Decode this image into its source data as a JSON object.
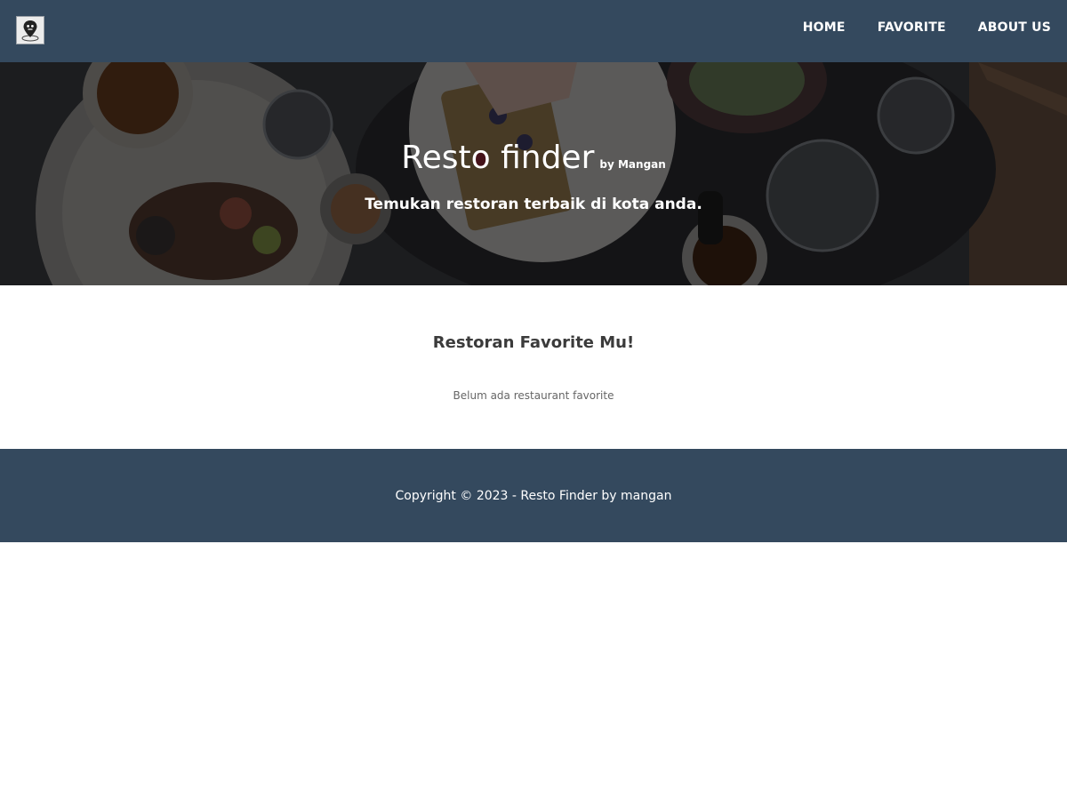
{
  "header": {
    "logo_icon": "map-pin-logo-icon",
    "nav": [
      {
        "label": "HOME"
      },
      {
        "label": "FAVORITE"
      },
      {
        "label": "ABOUT US"
      }
    ],
    "background_color": "#34495e"
  },
  "hero": {
    "title": "Resto finder",
    "byline": "by Mangan",
    "tagline": "Temukan restoran terbaik di kota anda."
  },
  "main": {
    "section_title": "Restoran Favorite Mu!",
    "empty_message": "Belum ada restaurant favorite"
  },
  "footer": {
    "copyright": "Copyright © 2023 - Resto Finder by mangan",
    "background_color": "#34495e"
  }
}
